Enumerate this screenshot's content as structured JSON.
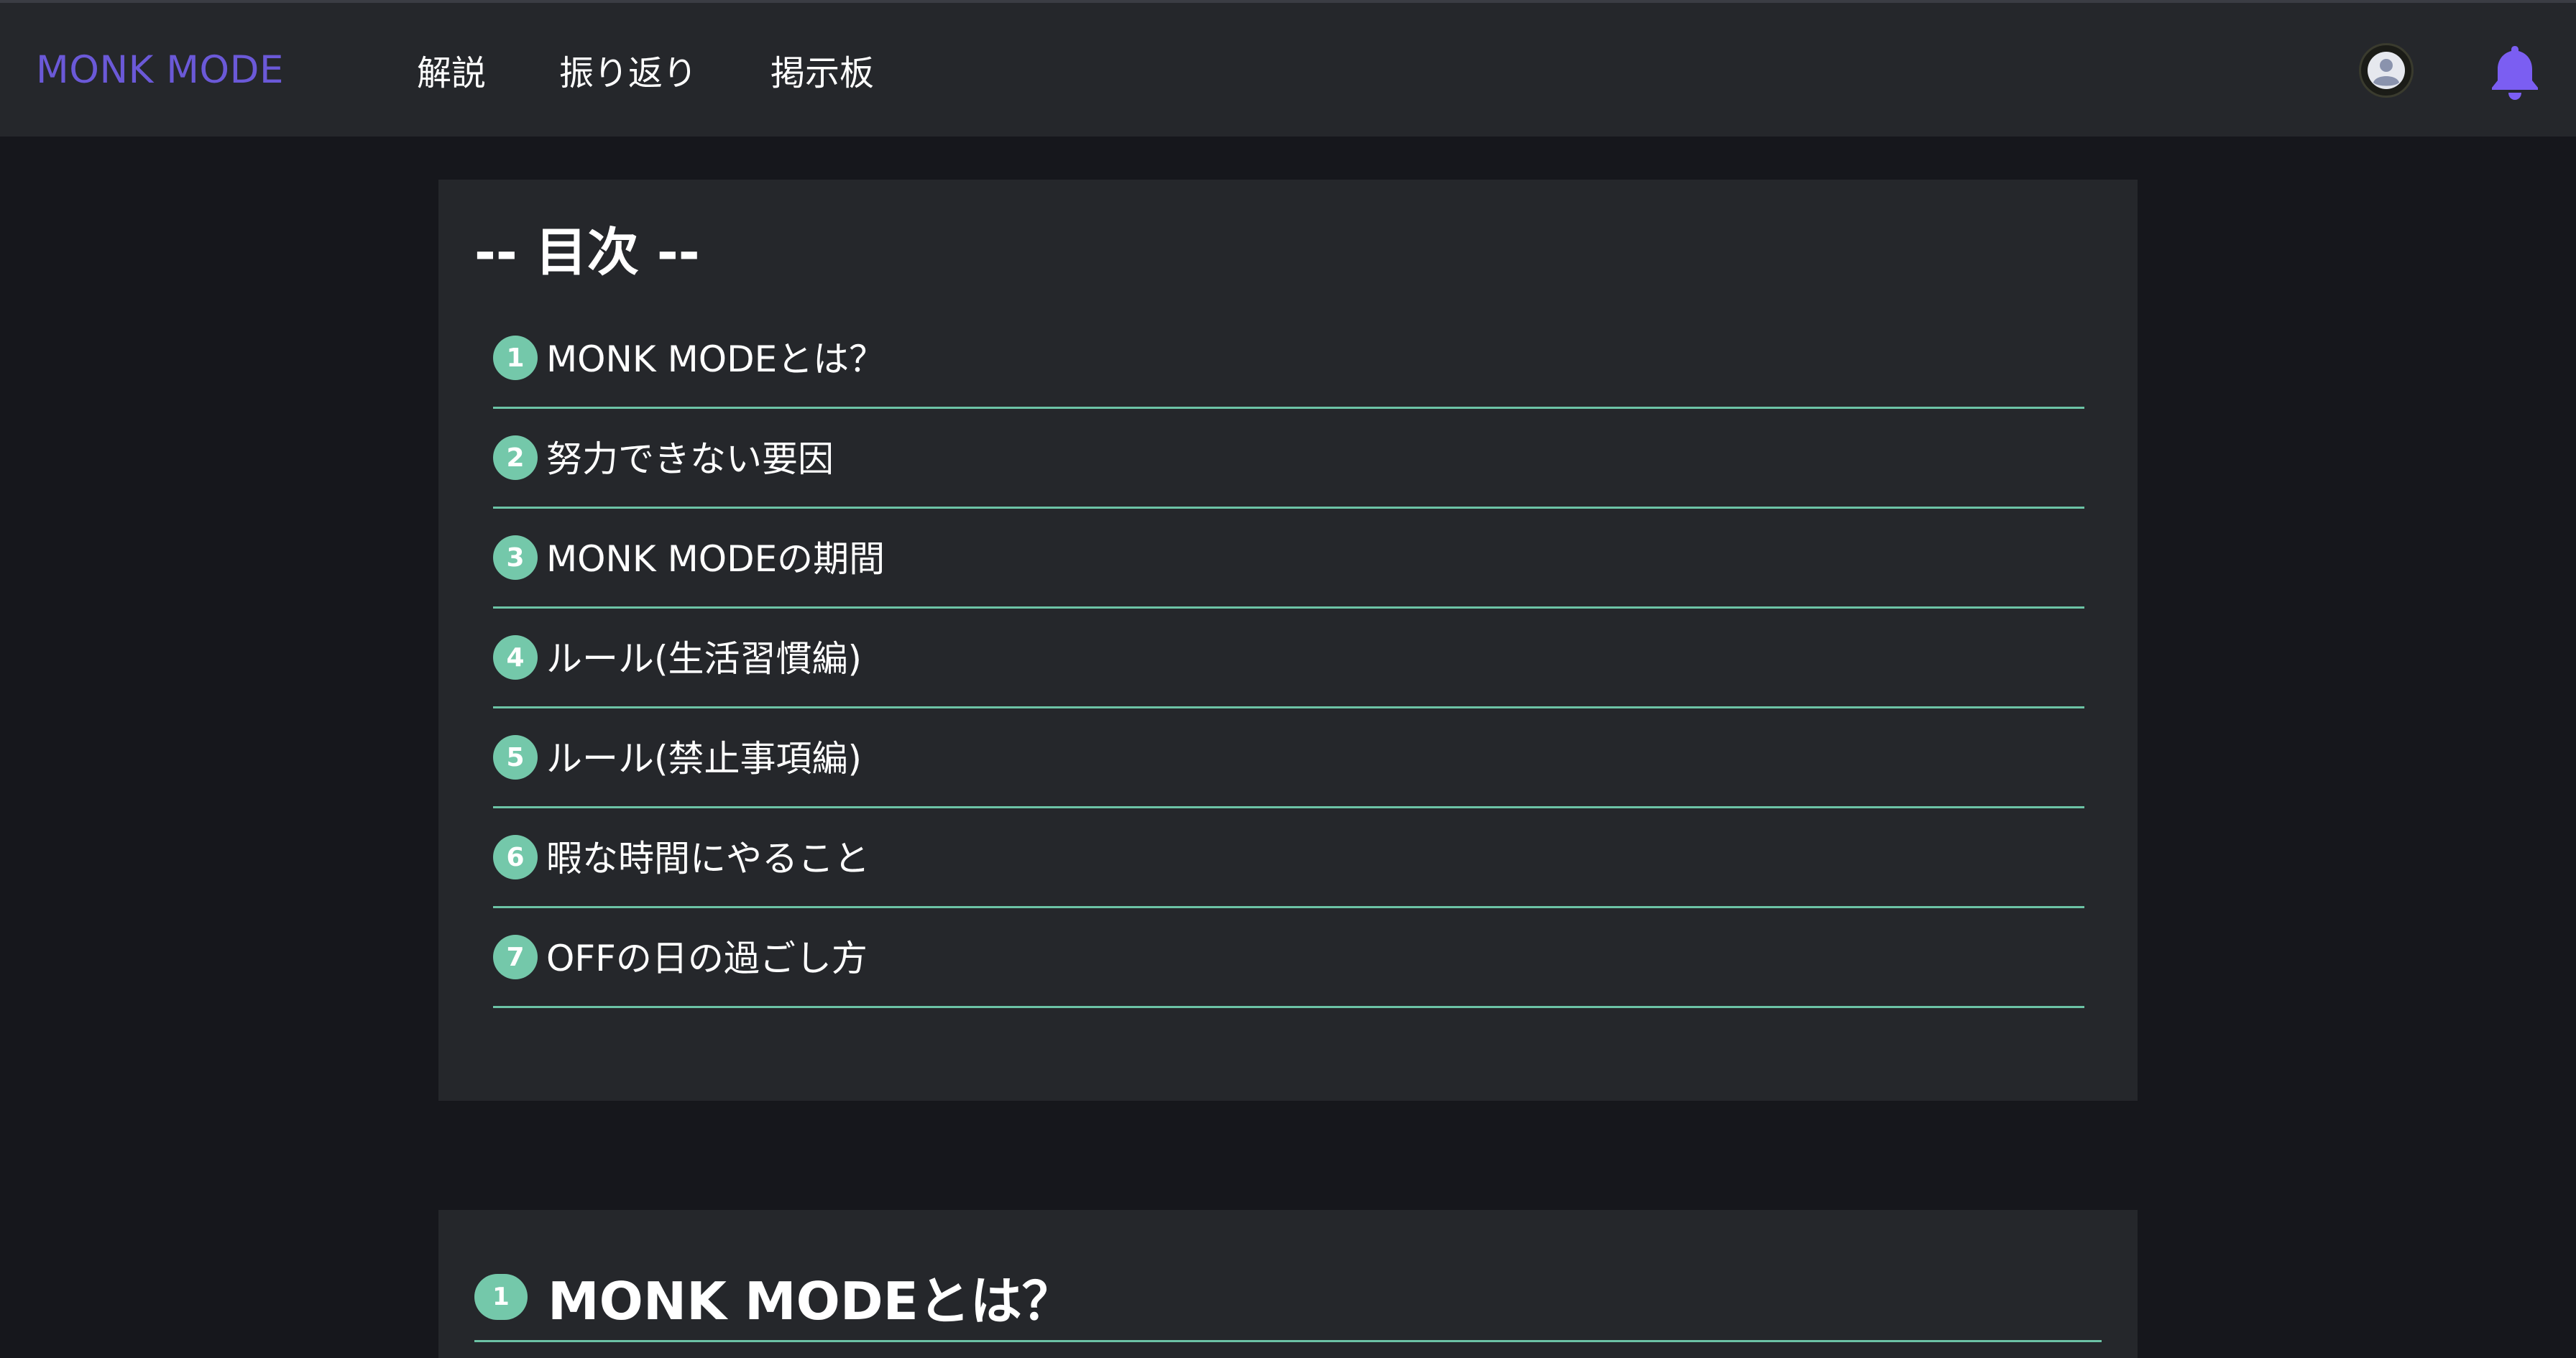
{
  "header": {
    "brand": "MONK MODE",
    "nav": [
      "解説",
      "振り返り",
      "掲示板"
    ],
    "icons": {
      "avatar": "user-avatar-icon",
      "bell": "bell-icon"
    },
    "colors": {
      "brand": "#6b59d8",
      "bar": "#25272b",
      "bell": "#7b5ef2"
    }
  },
  "toc": {
    "title": "-- 目次 --",
    "items": [
      {
        "num": "1",
        "label": "MONK MODEとは？"
      },
      {
        "num": "2",
        "label": "努力できない要因"
      },
      {
        "num": "3",
        "label": "MONK MODEの期間"
      },
      {
        "num": "4",
        "label": "ルール(生活習慣編)"
      },
      {
        "num": "5",
        "label": "ルール(禁止事項編)"
      },
      {
        "num": "6",
        "label": "暇な時間にやること"
      },
      {
        "num": "7",
        "label": "OFFの日の過ごし方"
      }
    ],
    "colors": {
      "accent": "#74c8aa",
      "card": "#25272b"
    }
  },
  "section": {
    "num": "1",
    "title": "MONK MODEとは？"
  },
  "theme": {
    "background": "#16171c"
  }
}
